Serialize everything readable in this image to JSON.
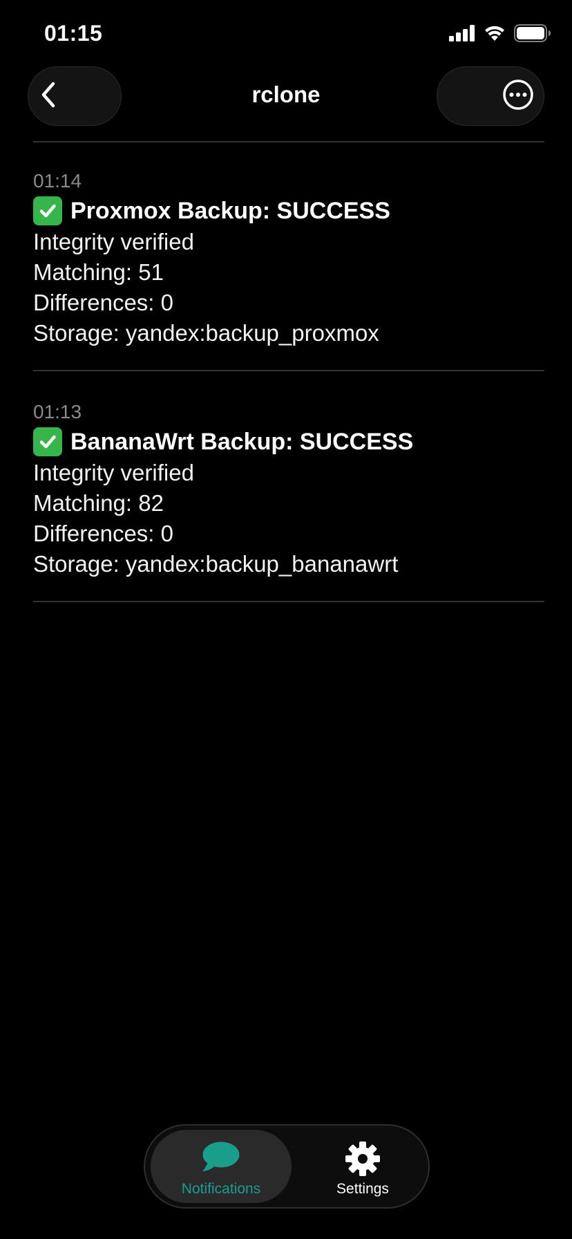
{
  "status_bar": {
    "time": "01:15",
    "icons": [
      "cellular-signal-icon",
      "wifi-icon",
      "battery-icon"
    ]
  },
  "nav": {
    "title": "rclone",
    "back_icon": "chevron-left-icon",
    "more_icon": "ellipsis-circle-icon"
  },
  "messages": [
    {
      "time": "01:14",
      "title": "Proxmox Backup: SUCCESS",
      "icon": "check-mark-button-emoji",
      "lines": [
        "Integrity verified",
        "Matching: 51",
        "Differences: 0",
        "Storage: yandex:backup_proxmox"
      ]
    },
    {
      "time": "01:13",
      "title": "BananaWrt Backup: SUCCESS",
      "icon": "check-mark-button-emoji",
      "lines": [
        "Integrity verified",
        "Matching: 82",
        "Differences: 0",
        "Storage: yandex:backup_bananawrt"
      ]
    }
  ],
  "tabbar": {
    "tabs": [
      {
        "label": "Notifications",
        "icon": "chat-bubble-icon",
        "selected": true
      },
      {
        "label": "Settings",
        "icon": "gear-icon",
        "selected": false
      }
    ]
  },
  "colors": {
    "background": "#000000",
    "accent": "#1a9e8c",
    "success": "#35b54a",
    "muted_text": "#8a8a8a"
  }
}
